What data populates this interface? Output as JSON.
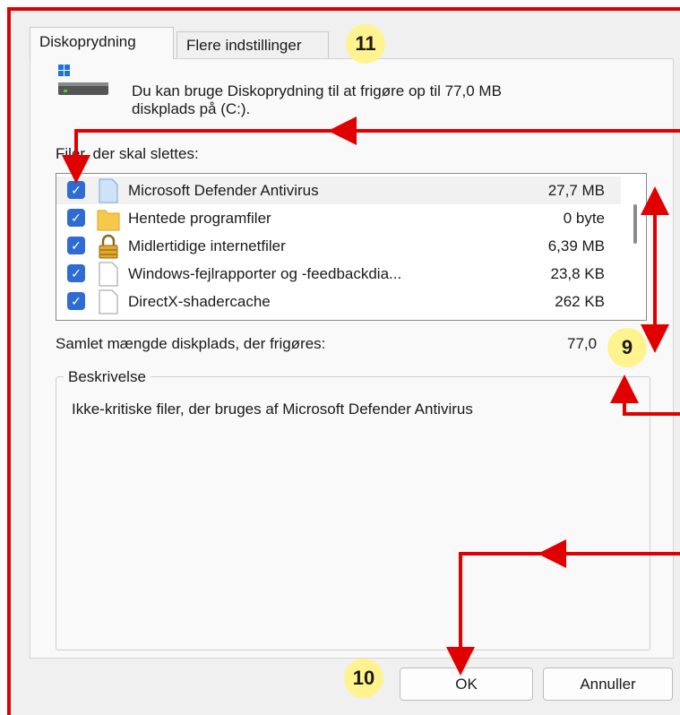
{
  "tabs": [
    {
      "label": "Diskoprydning",
      "active": true
    },
    {
      "label": "Flere indstillinger",
      "active": false
    }
  ],
  "intro_text_line1": "Du kan bruge Diskoprydning til at frigøre op til 77,0 MB",
  "intro_text_line2": "diskplads på  (C:).",
  "files_label": "Filer, der skal slettes:",
  "files": [
    {
      "name": "Microsoft Defender Antivirus",
      "size": "27,7 MB",
      "checked": true,
      "icon": "document-icon-blue"
    },
    {
      "name": "Hentede programfiler",
      "size": "0 byte",
      "checked": true,
      "icon": "folder-icon"
    },
    {
      "name": "Midlertidige internetfiler",
      "size": "6,39 MB",
      "checked": true,
      "icon": "lock-icon"
    },
    {
      "name": "Windows-fejlrapporter og -feedbackdia...",
      "size": "23,8 KB",
      "checked": true,
      "icon": "document-icon"
    },
    {
      "name": "DirectX-shadercache",
      "size": "262 KB",
      "checked": true,
      "icon": "document-icon"
    }
  ],
  "total_label": "Samlet mængde diskplads, der frigøres:",
  "total_value": "77,0",
  "description_legend": "Beskrivelse",
  "description_text": "Ikke-kritiske filer, der bruges af Microsoft Defender Antivirus",
  "buttons": {
    "ok": "OK",
    "cancel": "Annuller"
  },
  "badges": {
    "tabs": "11",
    "scroll": "9",
    "ok": "10"
  },
  "colors": {
    "annotation": "#e00000",
    "checkbox": "#2e6bd3",
    "badge": "#fff38f"
  }
}
